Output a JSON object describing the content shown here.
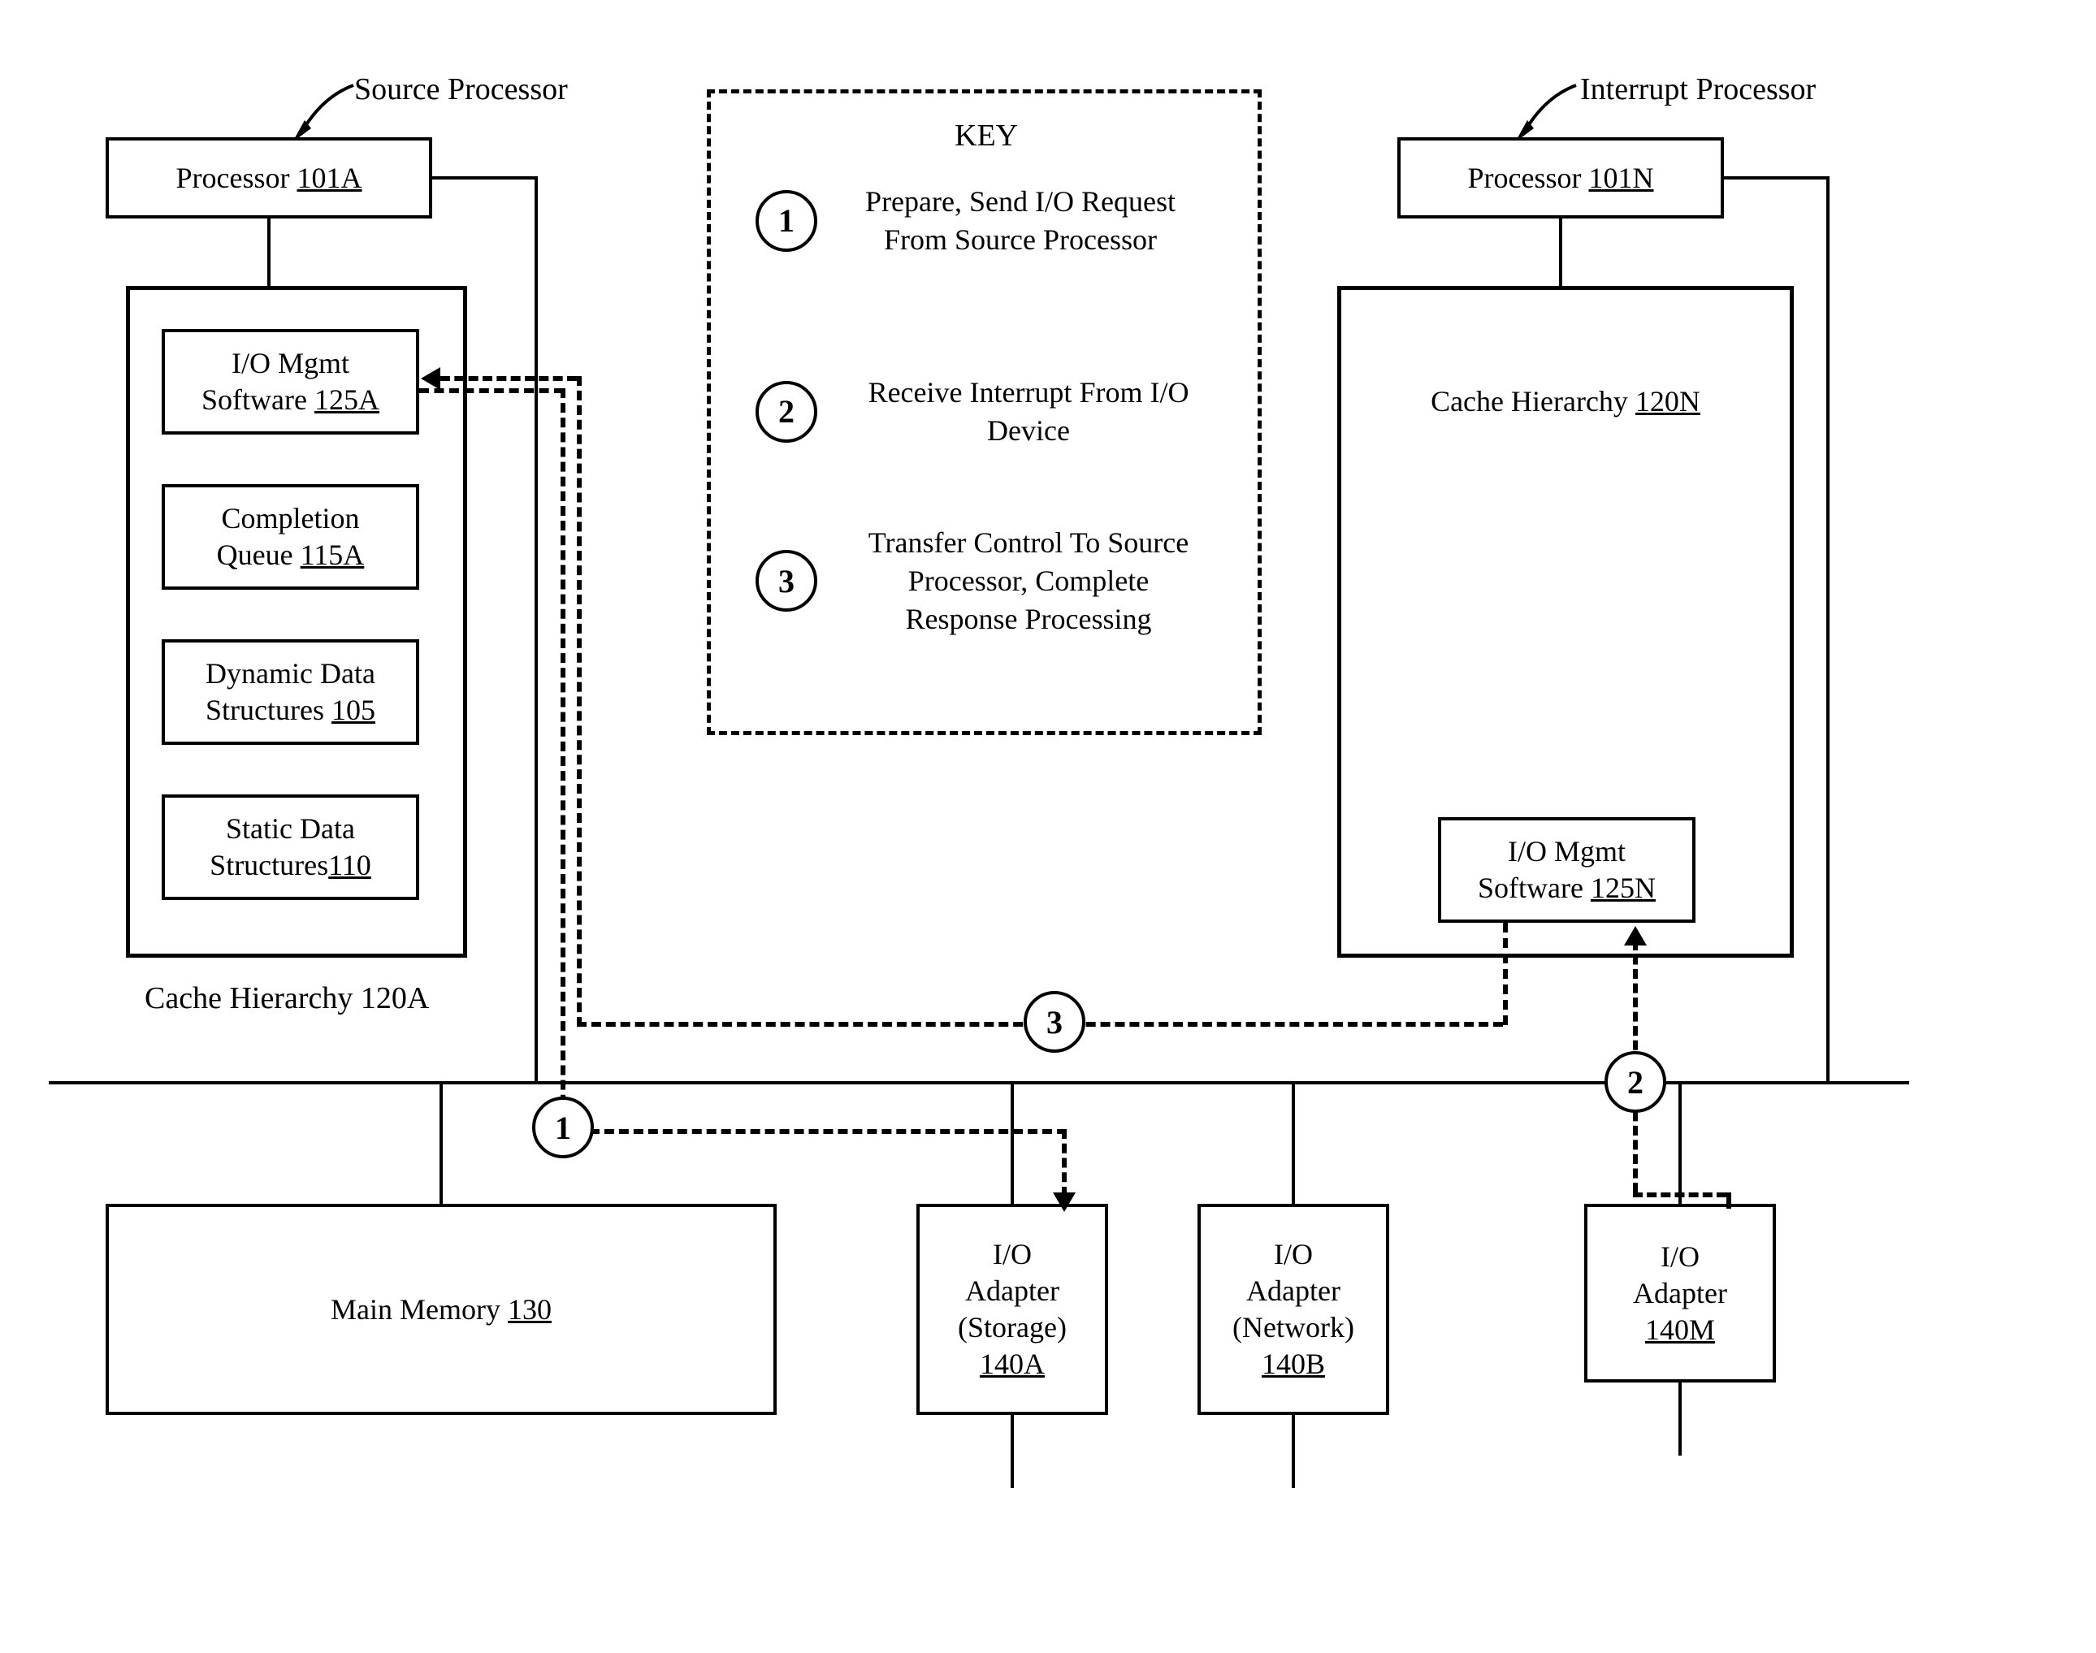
{
  "labels": {
    "sourceProcessor": "Source Processor",
    "interruptProcessor": "Interrupt Processor",
    "cacheHierarchyA": "Cache Hierarchy 120A",
    "keyTitle": "KEY"
  },
  "processorA": {
    "text": "Processor ",
    "ref": "101A"
  },
  "processorN": {
    "text": "Processor ",
    "ref": "101N"
  },
  "cacheN": {
    "text": "Cache Hierarchy ",
    "ref": "120N"
  },
  "ioMgmtA": {
    "line1": "I/O Mgmt",
    "line2pre": "Software ",
    "ref": "125A"
  },
  "completionQueue": {
    "line1": "Completion",
    "line2pre": "Queue ",
    "ref": "115A"
  },
  "dynamicData": {
    "line1": "Dynamic Data",
    "line2pre": "Structures ",
    "ref": "105"
  },
  "staticData": {
    "line1": "Static Data",
    "line2pre": "Structures",
    "ref": "110"
  },
  "ioMgmtN": {
    "line1": "I/O Mgmt",
    "line2pre": "Software ",
    "ref": "125N"
  },
  "mainMemory": {
    "text": "Main Memory ",
    "ref": "130"
  },
  "adapterA": {
    "line1": "I/O",
    "line2": "Adapter",
    "line3": "(Storage)",
    "ref": "140A"
  },
  "adapterB": {
    "line1": "I/O",
    "line2": "Adapter",
    "line3": "(Network)",
    "ref": "140B"
  },
  "adapterM": {
    "line1": "I/O",
    "line2": "Adapter",
    "ref": "140M"
  },
  "key": {
    "item1": {
      "num": "1",
      "text": "Prepare, Send I/O Request From Source Processor"
    },
    "item2": {
      "num": "2",
      "text": "Receive Interrupt From I/O Device"
    },
    "item3": {
      "num": "3",
      "text": "Transfer Control To Source Processor, Complete Response Processing"
    }
  },
  "flowNums": {
    "n1": "1",
    "n2": "2",
    "n3": "3"
  }
}
